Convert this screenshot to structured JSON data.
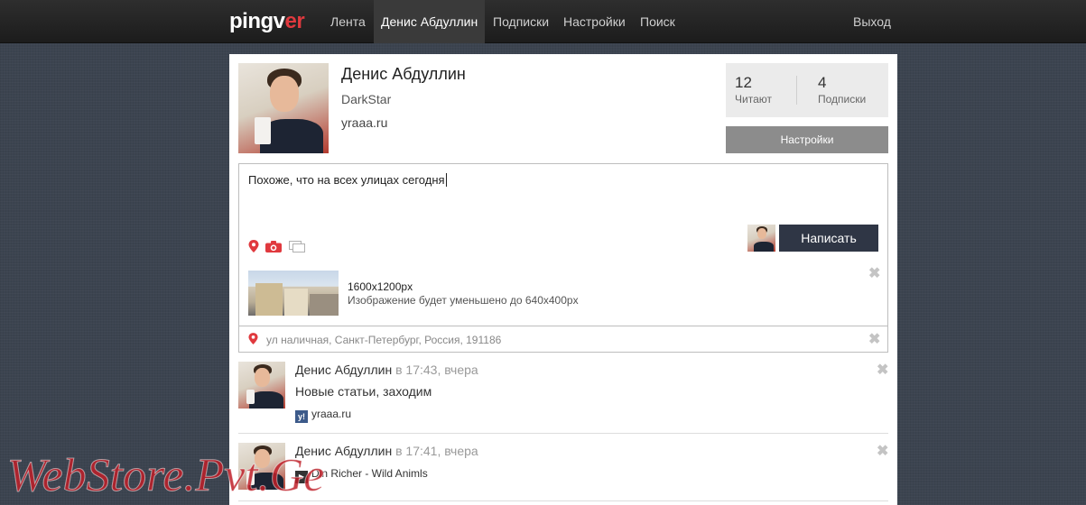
{
  "app": {
    "logo_main": "pingv",
    "logo_accent": "er"
  },
  "nav": {
    "items": [
      {
        "label": "Лента"
      },
      {
        "label": "Денис Абдуллин"
      },
      {
        "label": "Подписки"
      },
      {
        "label": "Настройки"
      },
      {
        "label": "Поиск"
      }
    ],
    "logout": "Выход"
  },
  "profile": {
    "name": "Денис Абдуллин",
    "login": "DarkStar",
    "website": "yraaa.ru",
    "followers_count": "12",
    "followers_label": "Читают",
    "following_count": "4",
    "following_label": "Подписки",
    "settings_button": "Настройки"
  },
  "composer": {
    "text": "Похоже, что на всех улицах сегодня",
    "submit_label": "Написать",
    "attachment_size": "1600x1200px",
    "attachment_note": "Изображение будет уменьшено до 640x400px",
    "location": "ул наличная, Санкт-Петербург, Россия, 191186"
  },
  "posts": [
    {
      "author": "Денис Абдуллин",
      "meta": "в 17:43, вчера",
      "text": "Новые статьи, заходим",
      "link_icon": "y!",
      "link_text": "yraaa.ru"
    },
    {
      "author": "Денис Абдуллин",
      "meta": "в 17:41, вчера",
      "link_icon": "▶",
      "link_text": "Din Richer - Wild Animls"
    }
  ],
  "icons": {
    "close": "✖",
    "location": "map-pin-icon",
    "camera": "camera-icon",
    "gallery": "gallery-icon"
  },
  "colors": {
    "accent": "#e0393e",
    "topbar": "#222222",
    "button_dark": "#2f3645",
    "button_gray": "#8c8c8c"
  },
  "watermark": "WebStore.Pvt.Ge"
}
